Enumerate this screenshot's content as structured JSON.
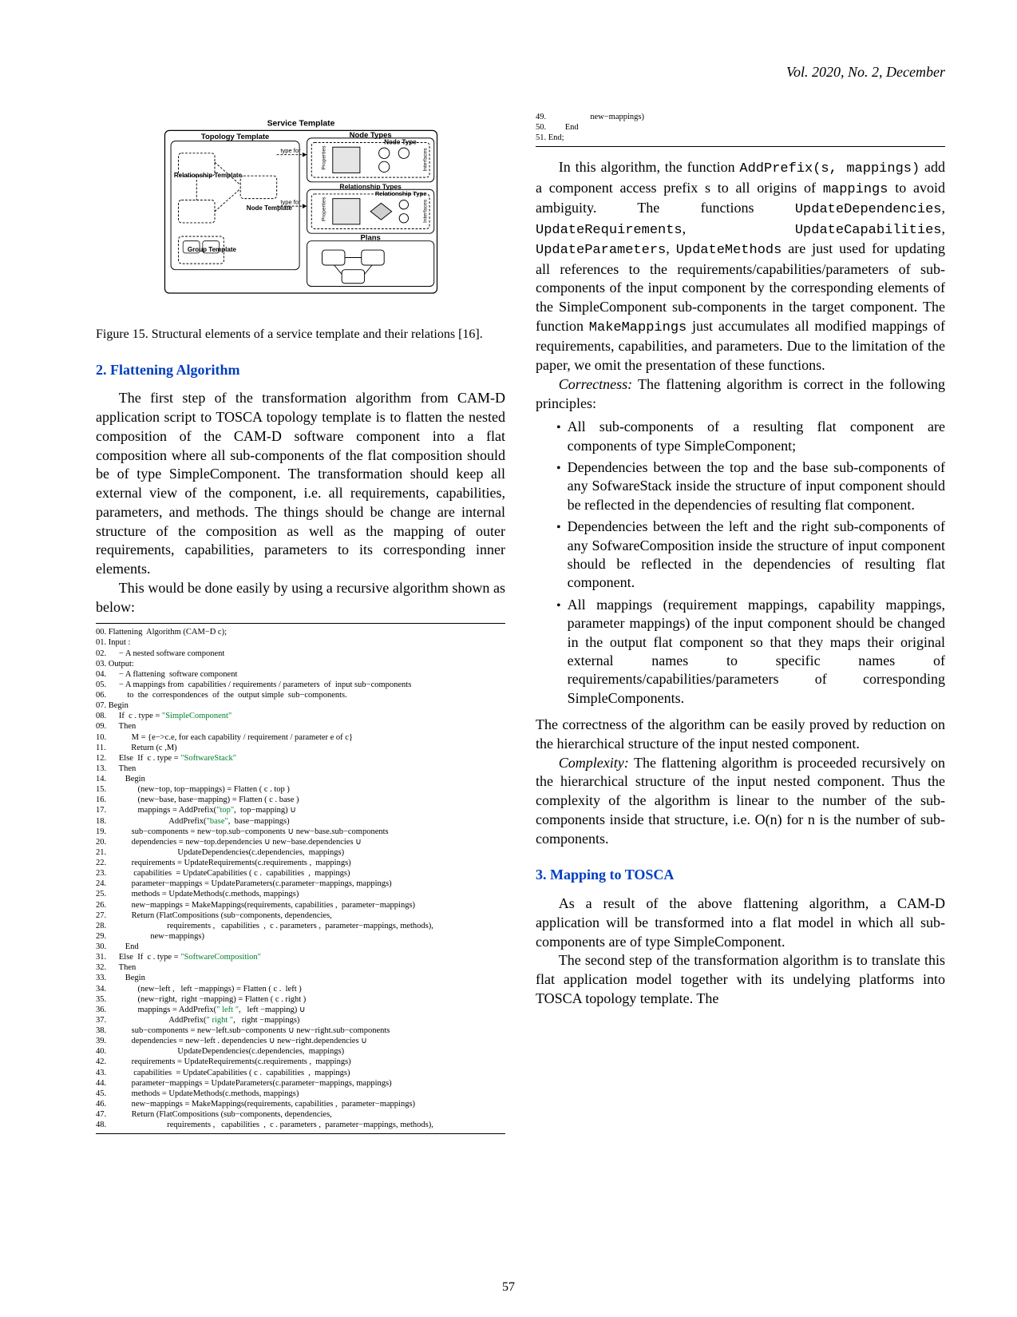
{
  "header": {
    "journal": "Vol. 2020, No. 2, December"
  },
  "page_number": "57",
  "figure": {
    "svc_template": "Service Template",
    "topology_template": "Topology Template",
    "node_types": "Node Types",
    "relationship_template": "Relationship Template",
    "node_template": "Node Template",
    "group_template": "Group Template",
    "node_type": "Node Type",
    "relationship_types": "Relationship Types",
    "relationship_type": "Relationship Type",
    "plans": "Plans",
    "type_for": "type for",
    "properties": "Properties",
    "interfaces": "Interfaces",
    "caption": "Figure 15.  Structural elements of a service template and their relations [16]."
  },
  "sections": {
    "flattening_heading": "2. Flattening Algorithm",
    "mapping_heading": "3. Mapping to TOSCA"
  },
  "paragraphs": {
    "p1": "The first step of the transformation algorithm from CAM-D application script to TOSCA topology template is to flatten the nested composition of the CAM-D software component into a flat composition where all sub-components of the flat composition should be of type SimpleComponent. The transformation should keep all external view of the component, i.e. all requirements, capabilities, parameters, and methods. The things should be change are internal structure of the composition as well as the mapping of outer requirements, capabilities, parameters to its corresponding inner elements.",
    "p2": "This would be done easily by using a recursive algorithm shown as below:",
    "p3a": "In this algorithm, the function ",
    "p3_code1": "AddPrefix(s, mappings)",
    "p3b": " add a component access prefix s to all origins of ",
    "p3_code2": "mappings",
    "p3c": " to avoid ambiguity. The functions ",
    "p3_code3": "UpdateDependencies",
    "p3_comma": ", ",
    "p3_code4": "UpdateRequirements",
    "p3_code5": "UpdateCapabilities",
    "p3_code6": "UpdateParameters",
    "p3_code7": "UpdateMethods",
    "p3d": " are just used for updating all references to the requirements/capabilities/parameters of sub-components of the input component by the corresponding elements of the SimpleComponent sub-components in the target component. The function ",
    "p3_code8": "MakeMappings",
    "p3e": " just accumulates all modified mappings of requirements, capabilities, and parameters. Due to the limitation of the paper, we omit the presentation of these functions.",
    "correctness_lead": "Correctness:",
    "correctness_text": " The flattening algorithm is correct in the following principles:",
    "bullet1": "All sub-components of a resulting flat component are components of type SimpleComponent;",
    "bullet2": "Dependencies between the top and the base sub-components of any SofwareStack inside the structure of input component should be reflected in the dependencies of resulting flat component.",
    "bullet3": "Dependencies between the left and the right sub-components of any SofwareComposition inside the structure of input component should be reflected in the dependencies of resulting flat component.",
    "bullet4": "All mappings (requirement mappings, capability mappings, parameter mappings) of the input component should be changed in the output flat component so that they maps their original external names to specific names of requirements/capabilities/parameters of corresponding SimpleComponents.",
    "p4": "The correctness of the algorithm can be easily proved by reduction on the hierarchical structure of the input nested component.",
    "complexity_lead": "Complexity:",
    "complexity_text": " The flattening algorithm is proceeded recursively on the hierarchical structure of the input nested component. Thus the complexity of the algorithm is linear to the number of the sub-components inside that structure, i.e. O(n) for n is the number of sub-components.",
    "p5": "As a result of the above flattening algorithm, a CAM-D application will be transformed into a flat model in which all sub-components are of type SimpleComponent.",
    "p6": "The second step of the transformation algorithm is to translate this flat application model together with its undelying platforms into TOSCA topology template. The"
  },
  "algorithm": {
    "lines_a": [
      "00. Flattening  Algorithm (CAM−D c);",
      "01. Input :",
      "02.      − A nested software component",
      "03. Output:",
      "04.      − A flattening  software component",
      "05.      − A mappings from  capabilities / requirements / parameters  of  input sub−components",
      "06.          to  the  correspondences  of  the  output simple  sub−components.",
      "07. Begin",
      "08.      If  c . type = \"SimpleComponent\"",
      "09.      Then",
      "10.            M = {e−>c.e, for each capability / requirement / parameter e of c}",
      "11.            Return (c ,M)",
      "12.      Else  If  c . type = \"SoftwareStack\"",
      "13.      Then",
      "14.         Begin",
      "15.               (new−top, top−mappings) = Flatten ( c . top )",
      "16.               (new−base, base−mapping) = Flatten ( c . base )",
      "17.               mappings = AddPrefix(\"top\",  top−mapping) ∪",
      "18.                              AddPrefix(\"base\",  base−mappings)",
      "19.            sub−components = new−top.sub−components ∪ new−base.sub−components",
      "20.            dependencies = new−top.dependencies ∪ new−base.dependencies ∪",
      "21.                                  UpdateDependencies(c.dependencies,  mappings)",
      "22.            requirements = UpdateRequirements(c.requirements ,  mappings)",
      "23.             capabilities  = UpdateCapabilities ( c .  capabilities  ,  mappings)",
      "24.            parameter−mappings = UpdateParameters(c.parameter−mappings, mappings)",
      "25.            methods = UpdateMethods(c.methods, mappings)",
      "26.            new−mappings = MakeMappings(requirements, capabilities ,  parameter−mappings)",
      "27.            Return (FlatCompositions (sub−components, dependencies,",
      "28.                             requirements ,   capabilities  ,  c . parameters ,  parameter−mappings, methods),",
      "29.                     new−mappings)",
      "30.         End",
      "31.      Else  If  c . type = \"SoftwareComposition\"",
      "32.      Then",
      "33.         Begin",
      "34.               (new−left ,   left −mappings) = Flatten ( c .  left )",
      "35.               (new−right,  right −mapping) = Flatten ( c . right )",
      "36.               mappings = AddPrefix(\" left \",   left −mapping) ∪",
      "37.                              AddPrefix(\" right \",   right −mappings)",
      "38.            sub−components = new−left.sub−components ∪ new−right.sub−components",
      "39.            dependencies = new−left . dependencies ∪ new−right.dependencies ∪",
      "40.                                  UpdateDependencies(c.dependencies,  mappings)",
      "42.            requirements = UpdateRequirements(c.requirements ,  mappings)",
      "43.             capabilities  = UpdateCapabilities ( c .  capabilities  ,  mappings)",
      "44.            parameter−mappings = UpdateParameters(c.parameter−mappings, mappings)",
      "45.            methods = UpdateMethods(c.methods, mappings)",
      "46.            new−mappings = MakeMappings(requirements, capabilities ,  parameter−mappings)",
      "47.            Return (FlatCompositions (sub−components, dependencies,",
      "48.                             requirements ,   capabilities  ,  c . parameters ,  parameter−mappings, methods),"
    ],
    "lines_b": [
      "49.                     new−mappings)",
      "50.         End",
      "51. End;"
    ],
    "green_tokens": [
      "\"SimpleComponent\"",
      "\"SoftwareStack\"",
      "\"top\"",
      "\"base\"",
      "\"SoftwareComposition\"",
      "\" left \"",
      "\" right \""
    ]
  }
}
